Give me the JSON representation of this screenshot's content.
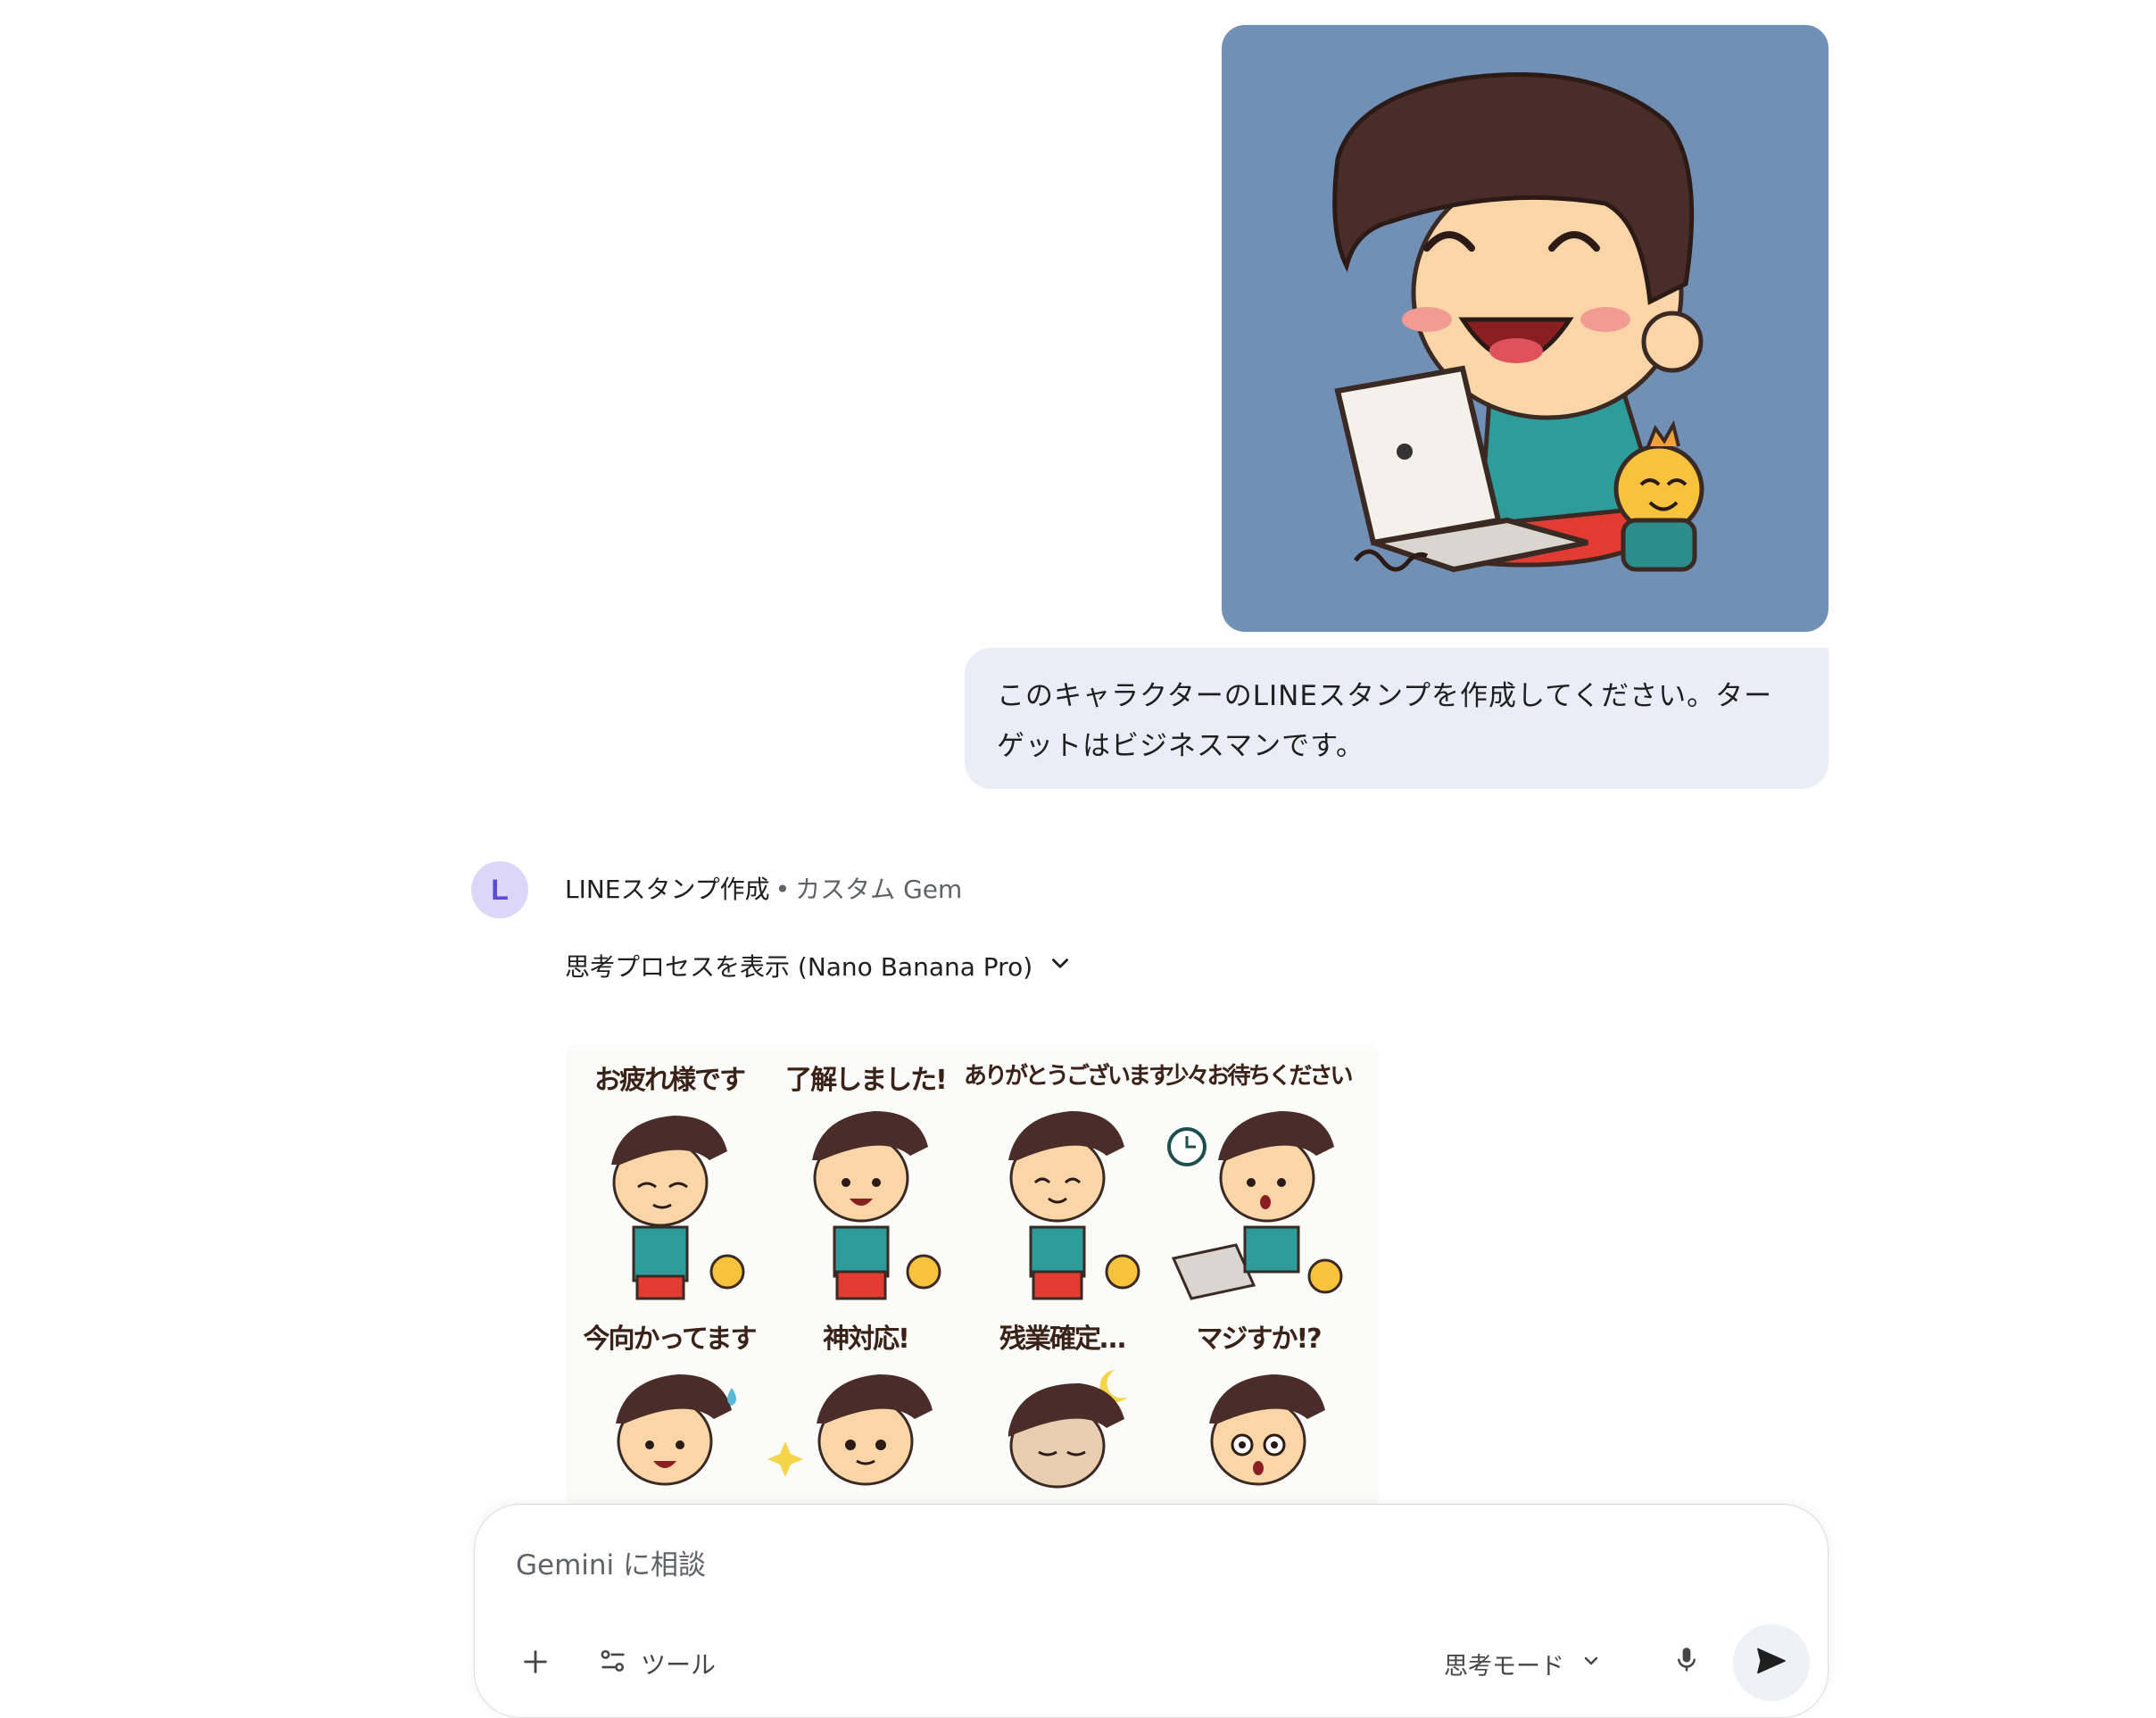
{
  "conversation": {
    "user_message": {
      "image_icon": "character-with-laptop-image",
      "text": "このキャラクターのLINEスタンプを作成してください。ターゲットはビジネスマンです。"
    },
    "response": {
      "avatar_letter": "L",
      "gem_name": "LINEスタンプ作成",
      "separator": "•",
      "gem_type": "カスタム Gem",
      "thinking_label": "思考プロセスを表示 (Nano Banana Pro)",
      "sticker_captions": [
        "お疲れ様です",
        "了解しました!",
        "ありがとうございます",
        "少々お待ちください",
        "今向かってます",
        "神対応!",
        "残業確定…",
        "マジすか!?"
      ]
    }
  },
  "composer": {
    "placeholder": "Gemini に相談",
    "add_icon": "plus-icon",
    "tools_label": "ツール",
    "tools_icon": "tune-icon",
    "mode_label": "思考モード",
    "mode_icon": "chevron-down-icon",
    "mic_icon": "mic-icon",
    "send_icon": "send-icon"
  },
  "colors": {
    "image_background": "#7190b6",
    "bubble_background": "#e9eef6",
    "avatar_background": "#ddd6fb",
    "avatar_letter": "#5b4bd6"
  }
}
